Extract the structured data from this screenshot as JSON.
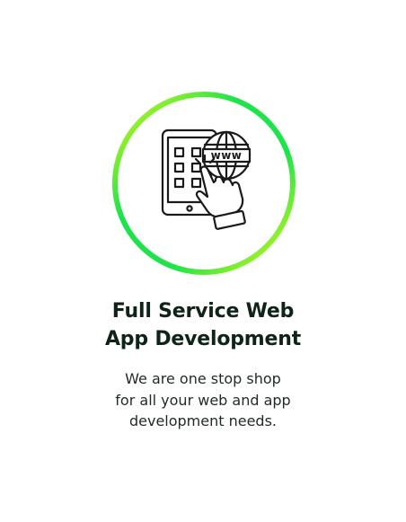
{
  "service": {
    "title_line1": "Full Service Web",
    "title_line2": "App Development",
    "desc_line1": "We are one stop shop",
    "desc_line2": "for all your web and app",
    "desc_line3": "development needs.",
    "icon": "tablet-tap-globe-icon",
    "globe_label": "www"
  },
  "colors": {
    "ring_green": "#1ee34a",
    "ring_yellow": "#dff71a",
    "title": "#0f2419",
    "text": "#1f2a24",
    "icon_stroke": "#1a1a1a"
  }
}
